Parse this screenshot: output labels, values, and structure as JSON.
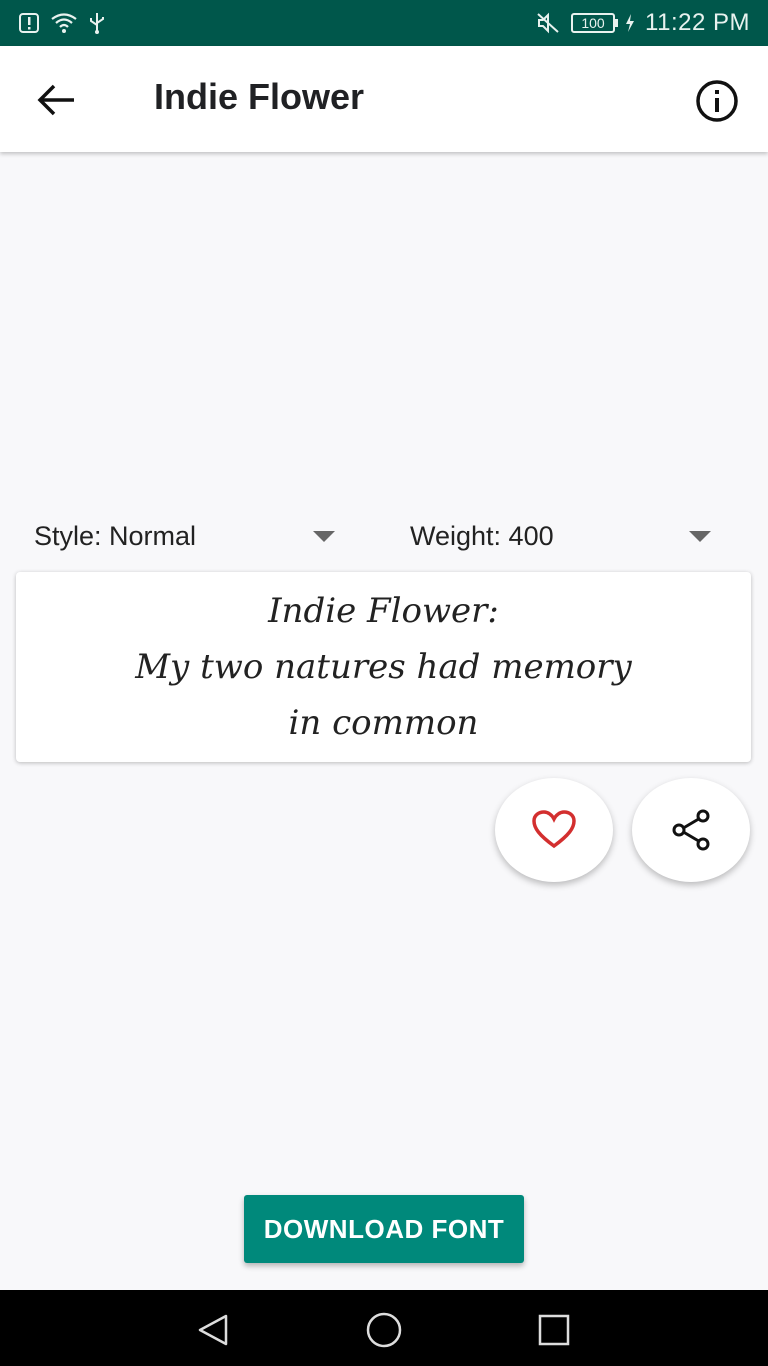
{
  "status_bar": {
    "battery": "100",
    "time": "11:22 PM"
  },
  "app_bar": {
    "title": "Indie Flower",
    "icons": [
      "back-arrow-icon",
      "info-icon"
    ]
  },
  "controls": {
    "style_label": "Style: Normal",
    "weight_label": "Weight: 400"
  },
  "preview": {
    "line1": "Indie Flower:",
    "line2": "My two natures had memory",
    "line3": "in common"
  },
  "actions": {
    "favorite_icon": "heart-outline-icon",
    "favorite_color": "#d32f2f",
    "share_icon": "share-icon"
  },
  "download_button": {
    "label": "DOWNLOAD FONT",
    "color": "#00897b"
  },
  "nav_bar": {
    "buttons": [
      "back-triangle-icon",
      "home-circle-icon",
      "recents-square-icon"
    ]
  }
}
